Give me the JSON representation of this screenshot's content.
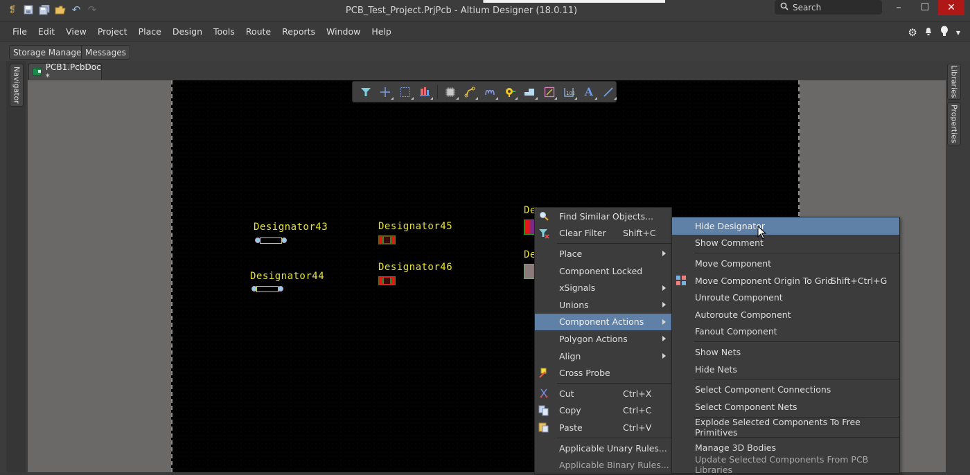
{
  "titlebar": {
    "title": "PCB_Test_Project.PrjPcb - Altium Designer (18.0.11)",
    "search_placeholder": "Search",
    "quick_access": [
      "app-icon",
      "save-icon",
      "save-all-icon",
      "open-folder-icon",
      "undo-icon",
      "redo-icon"
    ],
    "window_controls": {
      "minimize": "–",
      "maximize": "☐",
      "close": "✕"
    }
  },
  "menubar": {
    "items": [
      "File",
      "Edit",
      "View",
      "Project",
      "Place",
      "Design",
      "Tools",
      "Route",
      "Reports",
      "Window",
      "Help"
    ],
    "right_icons": [
      "gear-icon",
      "bell-icon",
      "user-icon"
    ]
  },
  "panels": {
    "tabs": [
      "Storage Manager",
      "Messages"
    ],
    "left_side": [
      "Navigator"
    ],
    "right_side": [
      "Libraries",
      "Properties"
    ]
  },
  "document": {
    "tab_label": "PCB1.PcbDoc *"
  },
  "toolbar": {
    "tools": [
      "filter",
      "cross-probe-add",
      "select-area",
      "align",
      "place-component",
      "route-track",
      "interactive-diff-pair",
      "place-via",
      "place-fill",
      "place-region",
      "place-room",
      "place-string",
      "place-line"
    ],
    "string_glyph": "A"
  },
  "canvas": {
    "designators": [
      {
        "label": "Designator43",
        "type": "through-hole"
      },
      {
        "label": "Designator44",
        "type": "through-hole"
      },
      {
        "label": "Designator45",
        "type": "smd"
      },
      {
        "label": "Designator46",
        "type": "smd"
      },
      {
        "label": "De",
        "type": "partial"
      },
      {
        "label": "De",
        "type": "partial"
      }
    ]
  },
  "context_menu": {
    "items": [
      {
        "label": "Find Similar Objects...",
        "icon": "magnifier-icon"
      },
      {
        "label": "Clear Filter",
        "shortcut": "Shift+C",
        "icon": "clear-filter-icon"
      },
      {
        "separator": true
      },
      {
        "label": "Place",
        "submenu": true
      },
      {
        "label": "Component Locked"
      },
      {
        "label": "xSignals",
        "submenu": true
      },
      {
        "label": "Unions",
        "submenu": true
      },
      {
        "label": "Component Actions",
        "submenu": true,
        "highlighted": true
      },
      {
        "label": "Polygon Actions",
        "submenu": true
      },
      {
        "label": "Align",
        "submenu": true
      },
      {
        "label": "Cross Probe",
        "icon": "cross-probe-icon"
      },
      {
        "separator": true
      },
      {
        "label": "Cut",
        "shortcut": "Ctrl+X",
        "icon": "scissors-icon"
      },
      {
        "label": "Copy",
        "shortcut": "Ctrl+C",
        "icon": "copy-icon"
      },
      {
        "label": "Paste",
        "shortcut": "Ctrl+V",
        "icon": "paste-icon"
      },
      {
        "separator": true
      },
      {
        "label": "Applicable Unary Rules..."
      },
      {
        "label": "Applicable Binary Rules...",
        "dim": true
      }
    ]
  },
  "submenu": {
    "items": [
      {
        "label": "Hide Designator",
        "highlighted": true
      },
      {
        "label": "Show Comment"
      },
      {
        "separator": true
      },
      {
        "label": "Move Component"
      },
      {
        "label": "Move Component Origin To Grid",
        "shortcut": "Shift+Ctrl+G",
        "icon": "grid-origin-icon"
      },
      {
        "label": "Unroute Component"
      },
      {
        "label": "Autoroute Component"
      },
      {
        "label": "Fanout Component"
      },
      {
        "separator": true
      },
      {
        "label": "Show Nets"
      },
      {
        "label": "Hide Nets"
      },
      {
        "separator": true
      },
      {
        "label": "Select Component Connections"
      },
      {
        "label": "Select Component Nets"
      },
      {
        "separator": true
      },
      {
        "label": "Explode Selected Components To Free Primitives"
      },
      {
        "separator": true
      },
      {
        "label": "Manage 3D Bodies"
      },
      {
        "label": "Update Selected Components From PCB Libraries",
        "dim": true
      }
    ]
  },
  "colors": {
    "highlight": "#5f81a8",
    "designator_text": "#e6e23a",
    "board_bg": "#000000",
    "close_button": "#b01717"
  }
}
